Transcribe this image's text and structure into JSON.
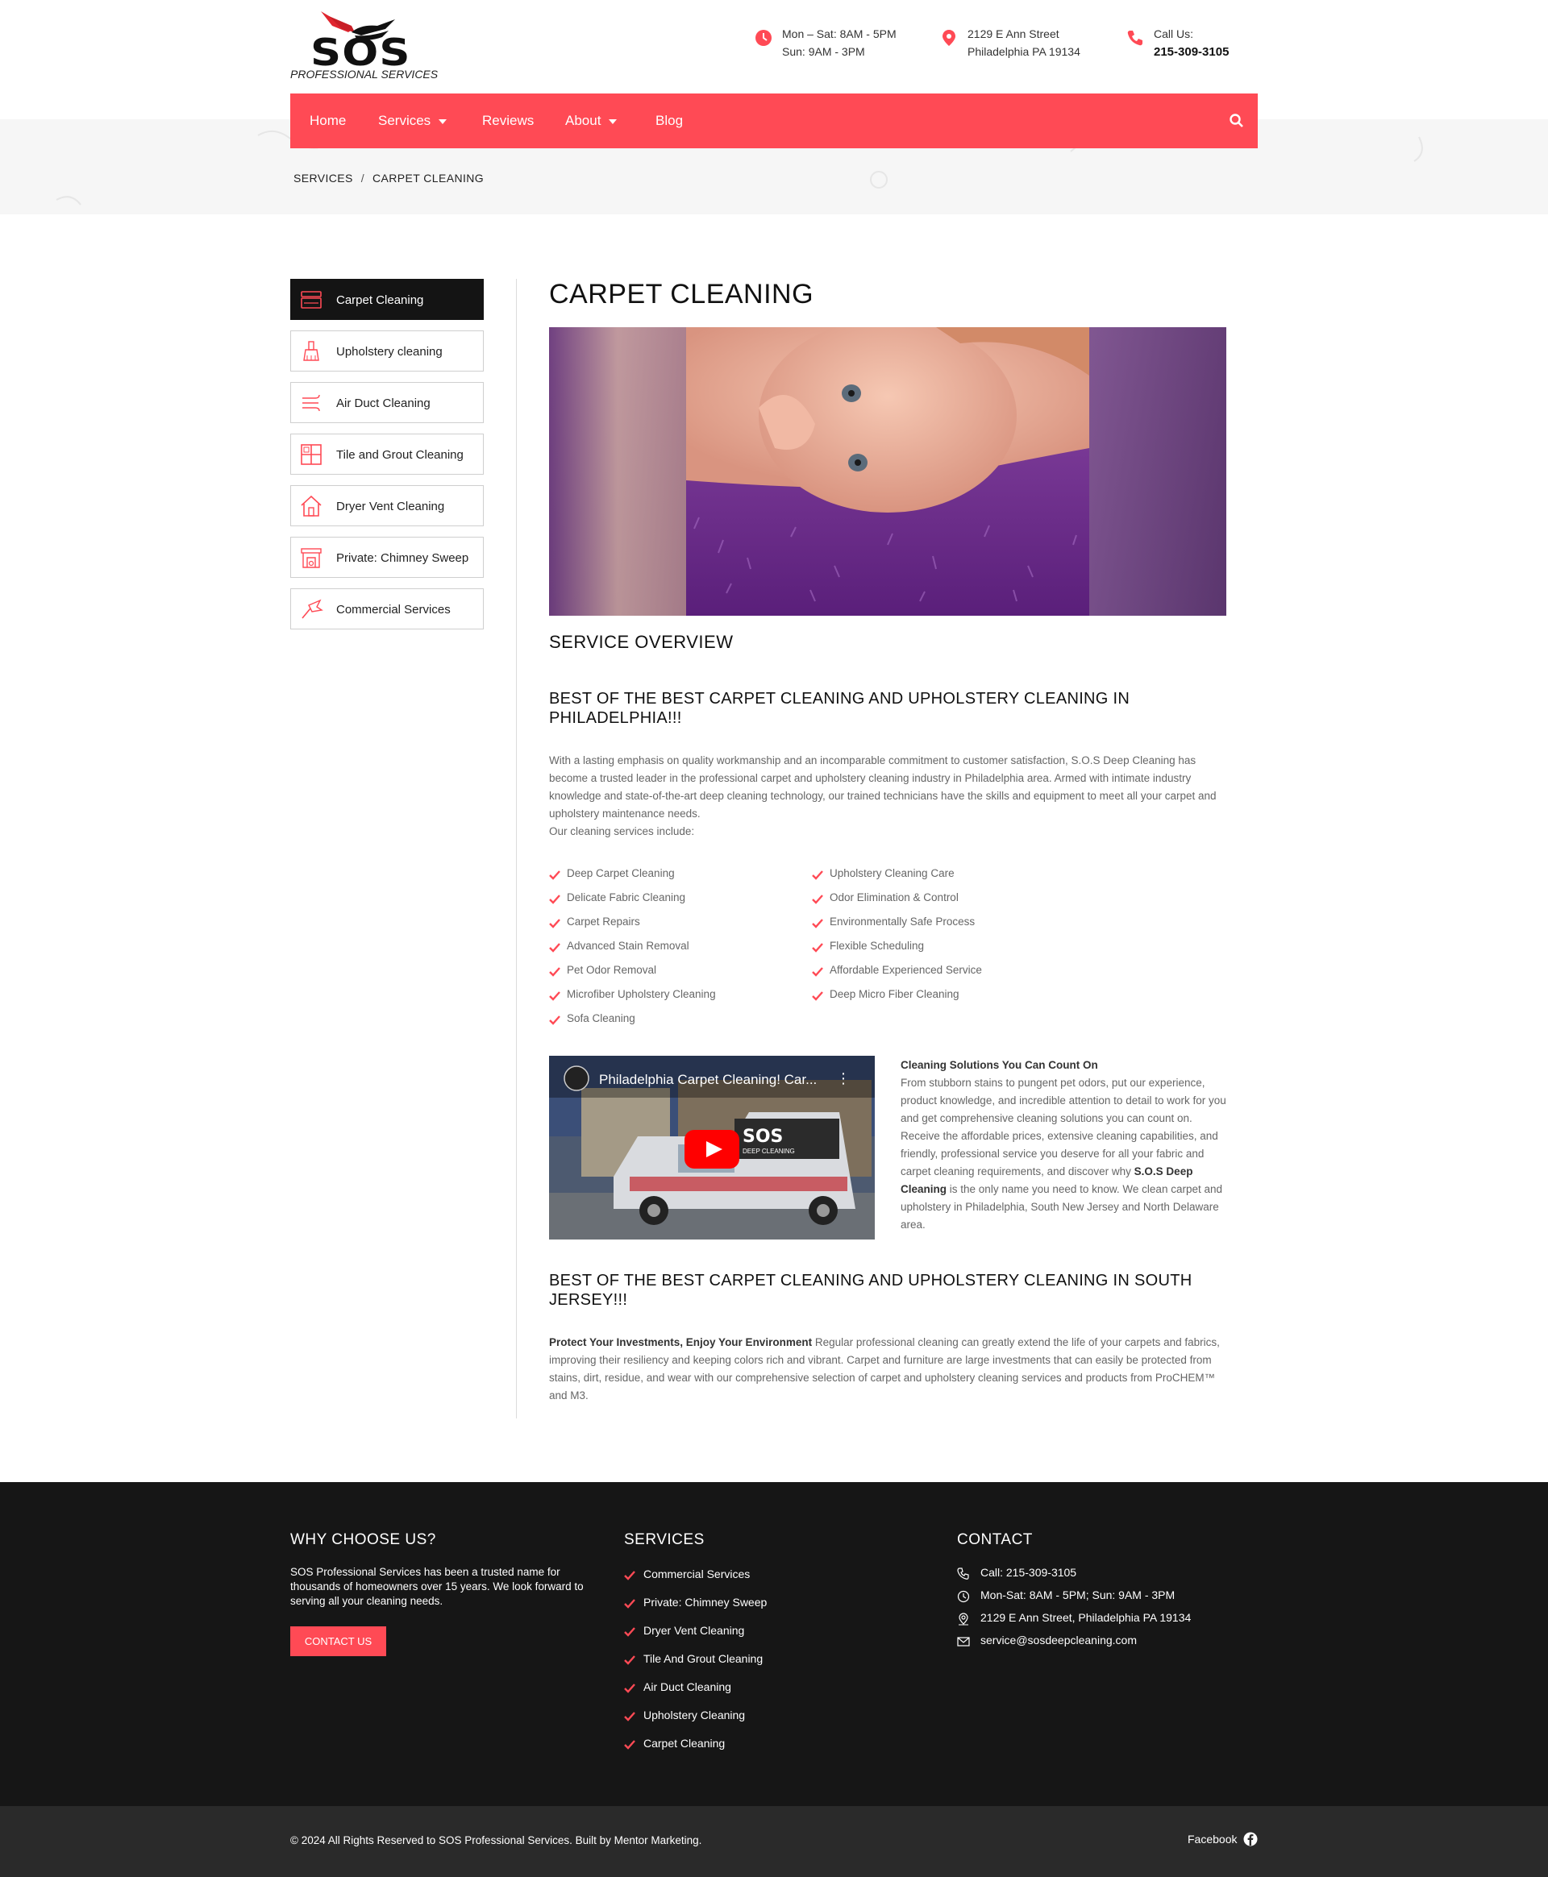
{
  "brand": {
    "logo_text": "SOS",
    "logo_sub": "PROFESSIONAL SERVICES",
    "accent": "#ff4a55",
    "dark": "#161616"
  },
  "header": {
    "hours_line1": "Mon – Sat: 8AM - 5PM",
    "hours_line2": "Sun: 9AM - 3PM",
    "address_line1": "2129 E Ann Street",
    "address_line2": "Philadelphia PA 19134",
    "call_label": "Call Us:",
    "call_number": "215-309-3105",
    "icons": [
      "clock-icon",
      "map-pin-icon",
      "phone-icon"
    ]
  },
  "nav": {
    "items": [
      {
        "label": "Home"
      },
      {
        "label": "Services"
      },
      {
        "label": "Reviews"
      },
      {
        "label": "About"
      },
      {
        "label": "Blog"
      }
    ],
    "search_icon": "search-icon"
  },
  "breadcrumb": {
    "parent": "SERVICES",
    "separator": "/",
    "current": "CARPET CLEANING"
  },
  "sidebar": {
    "items": [
      {
        "label": "Carpet Cleaning",
        "icon": "carpet-icon"
      },
      {
        "label": "Upholstery cleaning",
        "icon": "brush-icon"
      },
      {
        "label": "Air Duct Cleaning",
        "icon": "air-flow-icon"
      },
      {
        "label": "Tile and Grout Cleaning",
        "icon": "tile-icon"
      },
      {
        "label": "Dryer Vent Cleaning",
        "icon": "house-icon"
      },
      {
        "label": "Private: Chimney Sweep",
        "icon": "fireplace-icon"
      },
      {
        "label": "Commercial Services",
        "icon": "duster-icon"
      }
    ]
  },
  "main": {
    "title": "CARPET CLEANING",
    "overview_title": "SERVICE OVERVIEW",
    "heading1": "BEST OF THE BEST CARPET CLEANING AND UPHOLSTERY CLEANING IN PHILADELPHIA!!!",
    "intro": "With a lasting emphasis on quality workmanship and an incomparable commitment to customer satisfaction, S.O.S Deep Cleaning has become a trusted leader in the professional carpet and upholstery cleaning industry in Philadelphia area. Armed with intimate industry knowledge and state-of-the-art deep cleaning technology, our trained technicians have the skills and equipment to meet all your carpet and upholstery maintenance needs.",
    "includes": "Our cleaning services include:",
    "services_left": [
      "Deep Carpet Cleaning",
      "Delicate Fabric Cleaning",
      "Carpet Repairs",
      "Advanced Stain Removal",
      "Pet Odor Removal",
      "Microfiber Upholstery Cleaning",
      "Sofa Cleaning"
    ],
    "services_right": [
      "Upholstery Cleaning Care",
      "Odor Elimination & Control",
      "Environmentally Safe Process",
      "Flexible Scheduling",
      "Affordable Experienced Service",
      "Deep Micro Fiber Cleaning"
    ],
    "video_title": "Philadelphia Carpet Cleaning! Car...",
    "video_menu": "⋮",
    "video_van_text": "SOS",
    "video_van_sub": "DEEP CLEANING",
    "solutions_title": "Cleaning Solutions You Can Count On",
    "solutions_text_a": "From stubborn stains to pungent pet odors, put our experience, product knowledge, and incredible attention to detail to work for you and get comprehensive cleaning solutions you can count on. Receive the affordable prices, extensive cleaning capabilities, and friendly, professional service you deserve for all your fabric and carpet cleaning requirements, and discover why",
    "solutions_bold": "S.O.S Deep Cleaning",
    "solutions_text_b": "is the only name you need to know. We clean carpet and upholstery in Philadelphia, South New Jersey and North Delaware area.",
    "heading2": "BEST OF THE BEST CARPET CLEANING AND UPHOLSTERY CLEANING IN SOUTH JERSEY!!!",
    "protect_bold": "Protect Your Investments, Enjoy Your Environment",
    "protect_text": "Regular professional cleaning can greatly extend the life of your carpets and fabrics, improving their resiliency and keeping colors rich and vibrant. Carpet and furniture are large investments that can easily be protected from stains, dirt, residue, and wear with our comprehensive selection of carpet and upholstery cleaning services and products from ProCHEM™ and M3."
  },
  "footer": {
    "why_title": "WHY CHOOSE US?",
    "why_text": "SOS Professional Services has been a trusted name for thousands of homeowners over 15 years. We look forward to serving all your cleaning needs.",
    "contact_button": "CONTACT US",
    "services_title": "SERVICES",
    "services": [
      "Commercial Services",
      "Private: Chimney Sweep",
      "Dryer Vent Cleaning",
      "Tile And Grout Cleaning",
      "Air Duct Cleaning",
      "Upholstery Cleaning",
      "Carpet Cleaning"
    ],
    "contact_title": "CONTACT",
    "contact": [
      {
        "text": "Call: 215-309-3105",
        "icon": "phone-icon"
      },
      {
        "text": "Mon-Sat: 8AM - 5PM; Sun: 9AM - 3PM",
        "icon": "clock-icon"
      },
      {
        "text": "2129 E Ann Street, Philadelphia PA 19134",
        "icon": "map-pin-icon"
      },
      {
        "text": "service@sosdeepcleaning.com",
        "icon": "mail-icon"
      }
    ],
    "copyright": "© 2024 All Rights Reserved to SOS Professional Services. Built by Mentor Marketing.",
    "facebook": "Facebook"
  }
}
